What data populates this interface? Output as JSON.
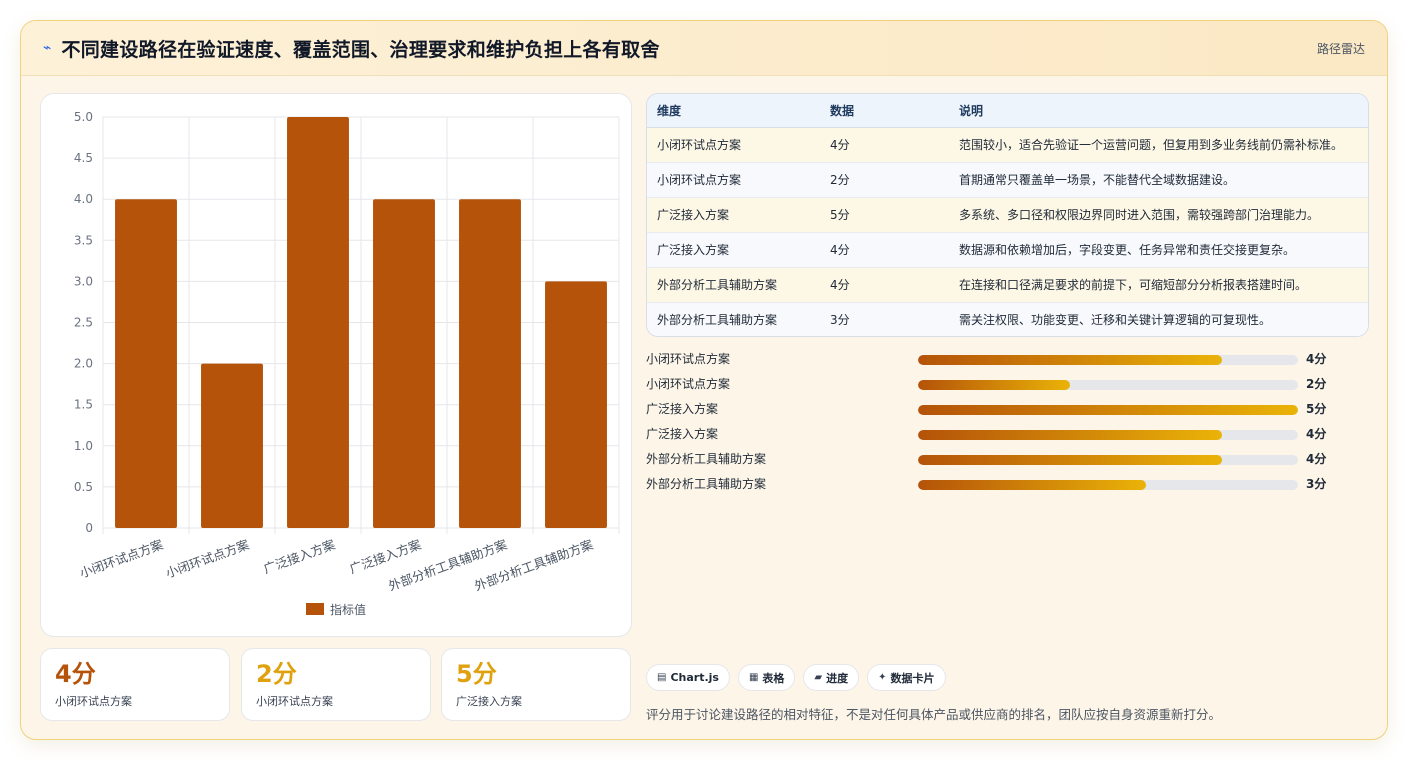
{
  "header": {
    "title": "不同建设路径在验证速度、覆盖范围、治理要求和维护负担上各有取舍",
    "tag": "路径雷达"
  },
  "chart_data": {
    "type": "bar",
    "categories": [
      "小闭环试点方案",
      "小闭环试点方案",
      "广泛接入方案",
      "广泛接入方案",
      "外部分析工具辅助方案",
      "外部分析工具辅助方案"
    ],
    "series": [
      {
        "name": "指标值",
        "values": [
          4,
          2,
          5,
          4,
          4,
          3
        ],
        "color": "#b45309"
      }
    ],
    "ylim": [
      0,
      5
    ],
    "yticks": [
      "0",
      "0.5",
      "1.0",
      "1.5",
      "2.0",
      "2.5",
      "3.0",
      "3.5",
      "4.0",
      "4.5",
      "5.0"
    ],
    "grid": true,
    "legend": "bottom"
  },
  "kpis": [
    {
      "value": "4分",
      "label": "小闭环试点方案",
      "color": "#b45309"
    },
    {
      "value": "2分",
      "label": "小闭环试点方案",
      "color": "#e0a10e"
    },
    {
      "value": "5分",
      "label": "广泛接入方案",
      "color": "#e0a10e"
    }
  ],
  "table": {
    "headers": [
      "维度",
      "数据",
      "说明"
    ],
    "rows": [
      [
        "小闭环试点方案",
        "4分",
        "范围较小，适合先验证一个运营问题，但复用到多业务线前仍需补标准。"
      ],
      [
        "小闭环试点方案",
        "2分",
        "首期通常只覆盖单一场景，不能替代全域数据建设。"
      ],
      [
        "广泛接入方案",
        "5分",
        "多系统、多口径和权限边界同时进入范围，需较强跨部门治理能力。"
      ],
      [
        "广泛接入方案",
        "4分",
        "数据源和依赖增加后，字段变更、任务异常和责任交接更复杂。"
      ],
      [
        "外部分析工具辅助方案",
        "4分",
        "在连接和口径满足要求的前提下，可缩短部分分析报表搭建时间。"
      ],
      [
        "外部分析工具辅助方案",
        "3分",
        "需关注权限、功能变更、迁移和关键计算逻辑的可复现性。"
      ]
    ]
  },
  "progress": [
    {
      "label": "小闭环试点方案",
      "value": "4分",
      "fraction": 0.8
    },
    {
      "label": "小闭环试点方案",
      "value": "2分",
      "fraction": 0.4
    },
    {
      "label": "广泛接入方案",
      "value": "5分",
      "fraction": 1.0
    },
    {
      "label": "广泛接入方案",
      "value": "4分",
      "fraction": 0.8
    },
    {
      "label": "外部分析工具辅助方案",
      "value": "4分",
      "fraction": 0.8
    },
    {
      "label": "外部分析工具辅助方案",
      "value": "3分",
      "fraction": 0.6
    }
  ],
  "chips": [
    {
      "icon": "chart-icon",
      "glyph": "▤",
      "label": "Chart.js"
    },
    {
      "icon": "table-icon",
      "glyph": "▦",
      "label": "表格"
    },
    {
      "icon": "progress-icon",
      "glyph": "▰",
      "label": "进度"
    },
    {
      "icon": "card-icon",
      "glyph": "✦",
      "label": "数据卡片"
    }
  ],
  "note": "评分用于讨论建设路径的相对特征，不是对任何具体产品或供应商的排名，团队应按自身资源重新打分。"
}
